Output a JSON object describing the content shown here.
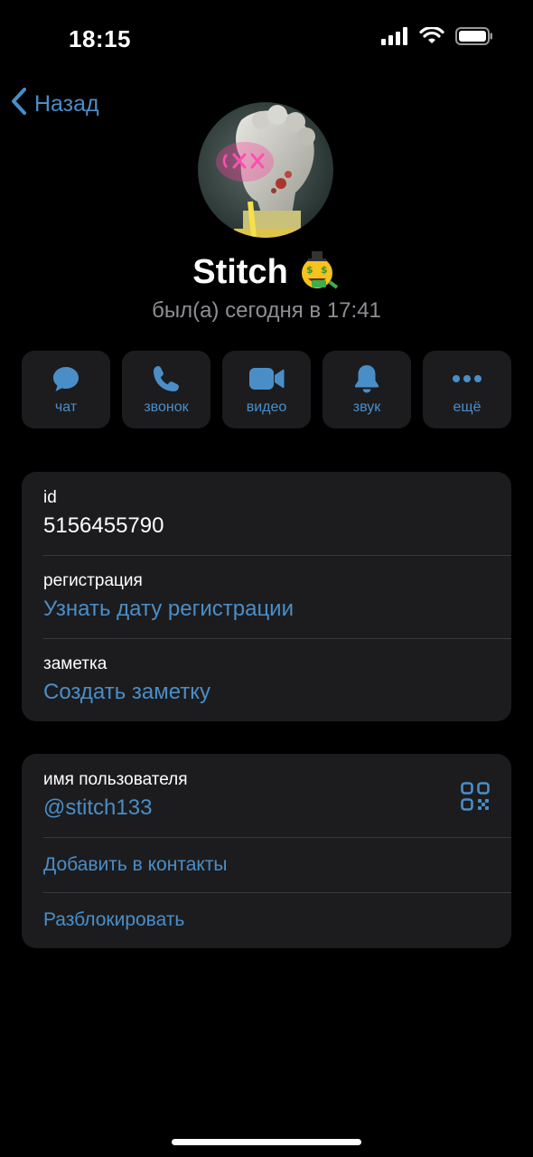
{
  "status_bar": {
    "time": "18:15"
  },
  "nav": {
    "back_label": "Назад"
  },
  "profile": {
    "name": "Stitch",
    "name_emoji": "🤑",
    "status": "был(а) сегодня в 17:41"
  },
  "actions": [
    {
      "label": "чат",
      "icon": "chat-bubble-icon"
    },
    {
      "label": "звонок",
      "icon": "phone-icon"
    },
    {
      "label": "видео",
      "icon": "video-camera-icon"
    },
    {
      "label": "звук",
      "icon": "bell-icon"
    },
    {
      "label": "ещё",
      "icon": "more-dots-icon"
    }
  ],
  "info": {
    "id_label": "id",
    "id_value": "5156455790",
    "registration_label": "регистрация",
    "registration_value": "Узнать дату регистрации",
    "note_label": "заметка",
    "note_value": "Создать заметку"
  },
  "user": {
    "username_label": "имя пользователя",
    "username_value": "@stitch133",
    "add_contact": "Добавить в контакты",
    "unblock": "Разблокировать"
  },
  "colors": {
    "accent": "#4a8ec8",
    "card": "#1c1c1e",
    "background": "#000000",
    "secondary_text": "#8e8e93"
  }
}
